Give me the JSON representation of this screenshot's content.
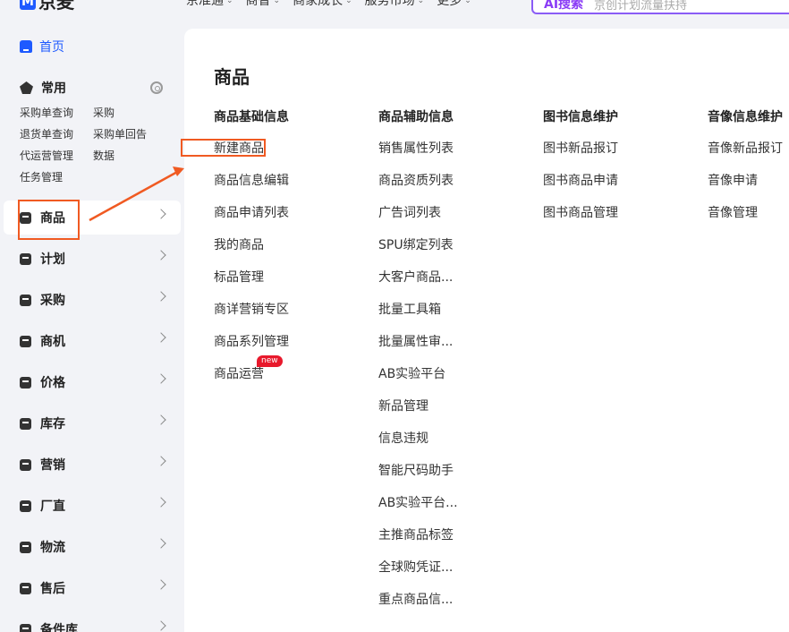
{
  "topbar": {
    "logo_mark": "M",
    "logo_text": "京麦",
    "nav": [
      "京准通",
      "商智",
      "商家成长",
      "服务市场",
      "更多"
    ],
    "search_ai_label": "AI搜索",
    "search_placeholder": "京创计划流量扶持"
  },
  "sidebar": {
    "home_label": "首页",
    "common_label": "常用",
    "quick_links": [
      "采购单查询",
      "采购",
      "退货单查询",
      "采购单回告",
      "代运营管理",
      "数据",
      "任务管理"
    ],
    "menu": [
      {
        "label": "商品",
        "icon": "product-icon",
        "active": true
      },
      {
        "label": "计划",
        "icon": "plan-icon"
      },
      {
        "label": "采购",
        "icon": "purchase-icon"
      },
      {
        "label": "商机",
        "icon": "opportunity-icon"
      },
      {
        "label": "价格",
        "icon": "price-icon"
      },
      {
        "label": "库存",
        "icon": "inventory-icon"
      },
      {
        "label": "营销",
        "icon": "marketing-icon"
      },
      {
        "label": "厂直",
        "icon": "factory-icon"
      },
      {
        "label": "物流",
        "icon": "logistics-icon"
      },
      {
        "label": "售后",
        "icon": "aftersale-icon"
      },
      {
        "label": "备件库",
        "icon": "spare-parts-icon"
      }
    ]
  },
  "panel": {
    "title": "商品",
    "columns": [
      {
        "title": "商品基础信息",
        "links": [
          "新建商品",
          "商品信息编辑",
          "商品申请列表",
          "我的商品",
          "标品管理",
          "商详营销专区",
          "商品系列管理",
          "商品运营"
        ],
        "badge": {
          "text": "new",
          "on_index": 7
        }
      },
      {
        "title": "商品辅助信息",
        "links": [
          "销售属性列表",
          "商品资质列表",
          "广告词列表",
          "SPU绑定列表",
          "大客户商品...",
          "批量工具箱",
          "批量属性审...",
          "AB实验平台",
          "新品管理",
          "信息违规",
          "智能尺码助手",
          "AB实验平台...",
          "主推商品标签",
          "全球购凭证...",
          "重点商品信..."
        ]
      },
      {
        "title": "图书信息维护",
        "links": [
          "图书新品报订",
          "图书商品申请",
          "图书商品管理"
        ]
      },
      {
        "title": "音像信息维护",
        "links": [
          "音像新品报订",
          "音像申请",
          "音像管理"
        ]
      }
    ]
  },
  "colors": {
    "accent": "#1e5aff",
    "highlight": "#f05a22",
    "ai_purple": "#8a3cf6",
    "badge_red": "#e8192c"
  }
}
